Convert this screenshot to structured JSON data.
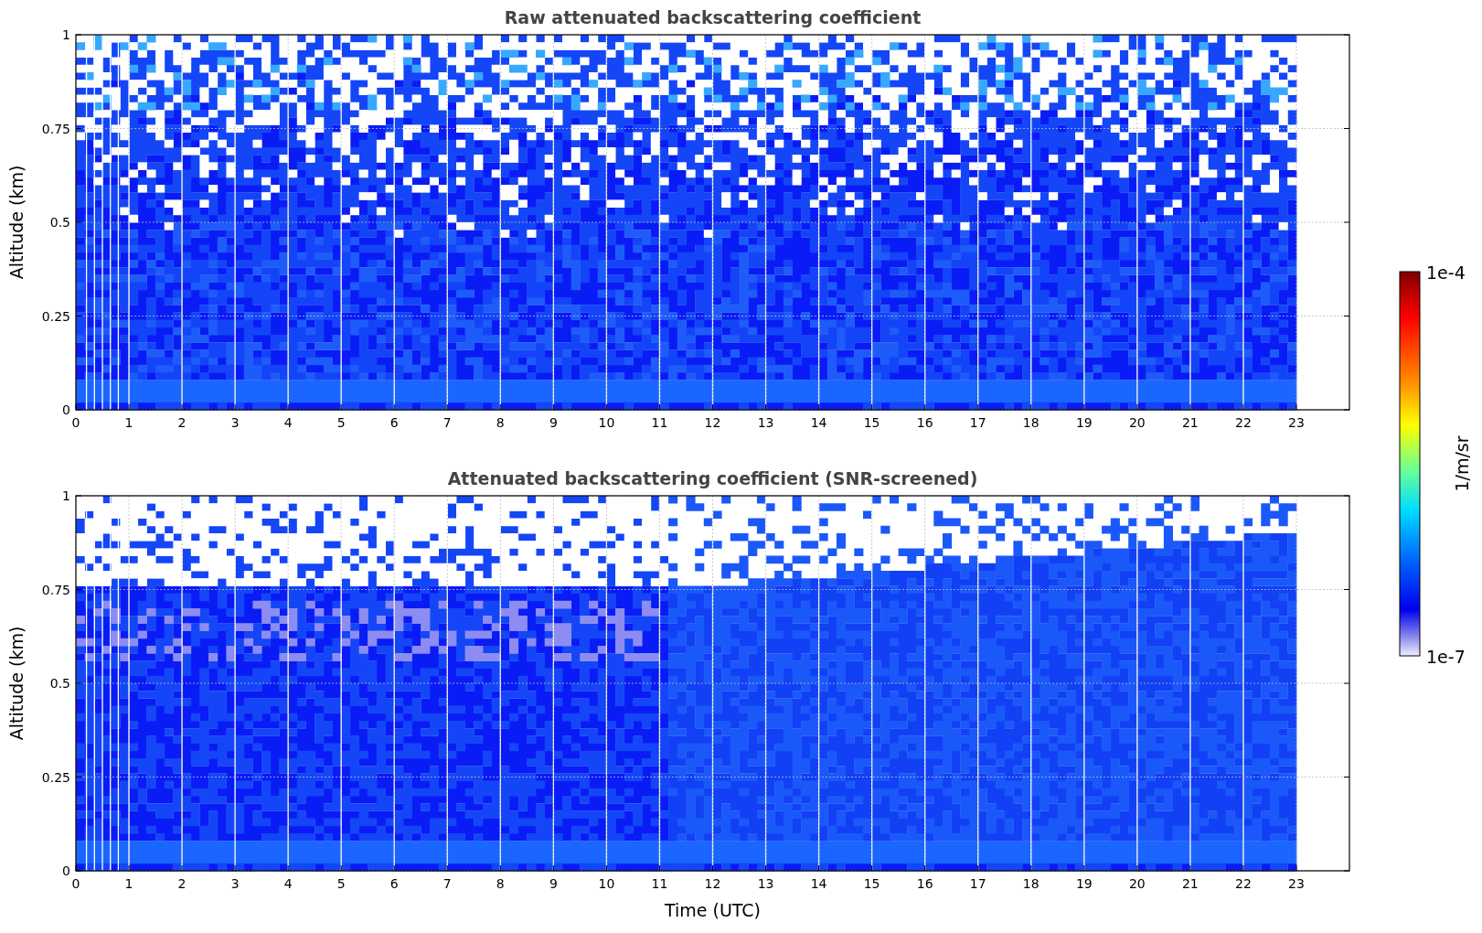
{
  "plots": [
    {
      "title": "Raw attenuated backscattering coefficient",
      "ylabel": "Altitude (km)",
      "yticks": [
        "1",
        "0.75",
        "0.5",
        "0.25",
        "0"
      ],
      "xticks": [
        "0",
        "1",
        "2",
        "3",
        "4",
        "5",
        "6",
        "7",
        "8",
        "9",
        "10",
        "11",
        "12",
        "13",
        "14",
        "15",
        "16",
        "17",
        "18",
        "19",
        "20",
        "21",
        "22",
        "23"
      ]
    },
    {
      "title": "Attenuated backscattering coefficient (SNR-screened)",
      "ylabel": "Altitude (km)",
      "yticks": [
        "1",
        "0.75",
        "0.5",
        "0.25",
        "0"
      ],
      "xticks": [
        "0",
        "1",
        "2",
        "3",
        "4",
        "5",
        "6",
        "7",
        "8",
        "9",
        "10",
        "11",
        "12",
        "13",
        "14",
        "15",
        "16",
        "17",
        "18",
        "19",
        "20",
        "21",
        "22",
        "23"
      ],
      "xlabel": "Time (UTC)"
    }
  ],
  "colorbar": {
    "label": "1/m/sr",
    "max_label": "1e-4",
    "min_label": "1e-7"
  }
}
